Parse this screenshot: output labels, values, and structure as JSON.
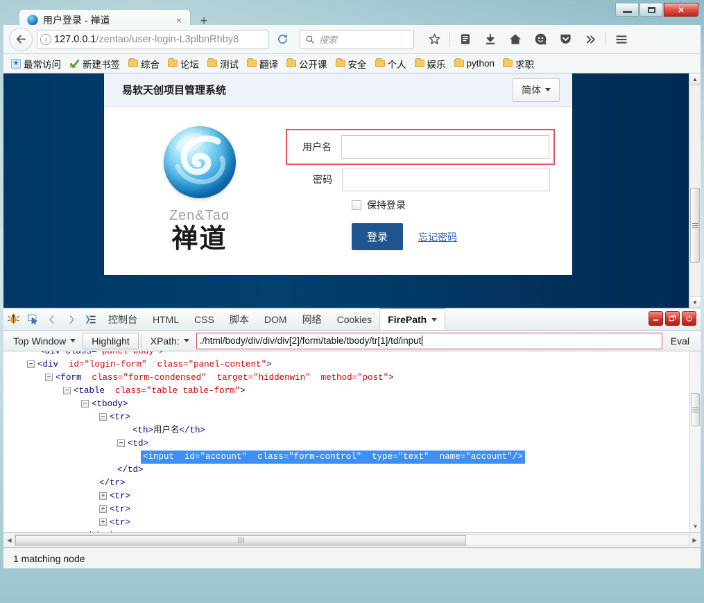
{
  "window": {
    "minimize_label": "Minimize",
    "maximize_label": "Maximize",
    "close_label": "×"
  },
  "browser": {
    "tab": {
      "title": "用户登录 - 禅道",
      "close_label": "×"
    },
    "new_tab_label": "+",
    "nav": {
      "back_label": "←",
      "url_host": "127.0.0.1",
      "url_path": "/zentao/user-login-L3plbnRhby8",
      "reload_label": "⟳",
      "search_placeholder": "搜索"
    },
    "bookmarks": [
      {
        "label": "最常访问",
        "icon": "most-visited-icon"
      },
      {
        "label": "新建书签",
        "icon": "check-icon"
      },
      {
        "label": "综合",
        "icon": "folder-icon"
      },
      {
        "label": "论坛",
        "icon": "folder-icon"
      },
      {
        "label": "测试",
        "icon": "folder-icon"
      },
      {
        "label": "翻译",
        "icon": "folder-icon"
      },
      {
        "label": "公开课",
        "icon": "folder-icon"
      },
      {
        "label": "安全",
        "icon": "folder-icon"
      },
      {
        "label": "个人",
        "icon": "folder-icon"
      },
      {
        "label": "娱乐",
        "icon": "folder-icon"
      },
      {
        "label": "python",
        "icon": "folder-icon"
      },
      {
        "label": "求职",
        "icon": "folder-icon"
      }
    ]
  },
  "page": {
    "panel_title": "易软天创项目管理系统",
    "language_button": "简体",
    "logo": {
      "text_en": "Zen&Tao",
      "text_cn": "禅道"
    },
    "form": {
      "account_label": "用户名",
      "account_value": "",
      "password_label": "密码",
      "password_value": "",
      "keep_login_label": "保持登录",
      "keep_login_checked": false,
      "login_button": "登录",
      "forgot_link": "忘记密码"
    }
  },
  "firebug": {
    "tabs": [
      {
        "label": "控制台",
        "active": false
      },
      {
        "label": "HTML",
        "active": false
      },
      {
        "label": "CSS",
        "active": false
      },
      {
        "label": "脚本",
        "active": false
      },
      {
        "label": "DOM",
        "active": false
      },
      {
        "label": "网络",
        "active": false
      },
      {
        "label": "Cookies",
        "active": false
      },
      {
        "label": "FirePath",
        "active": true
      }
    ],
    "window_buttons": [
      "minimize",
      "detach",
      "close"
    ],
    "xpath_bar": {
      "context_label": "Top Window",
      "highlight_label": "Highlight",
      "mode_label": "XPath:",
      "expression": "./html/body/div/div/div[2]/form/table/tbody/tr[1]/td/input",
      "eval_label": "Eval"
    },
    "tree": [
      {
        "indent": 0,
        "toggle": "none",
        "content": "partial",
        "text": "div  class=\"panel-body\""
      },
      {
        "indent": 0,
        "toggle": "minus",
        "tag": "div",
        "attrs": [
          [
            "id",
            "login-form"
          ],
          [
            "class",
            "panel-content"
          ]
        ]
      },
      {
        "indent": 1,
        "toggle": "minus",
        "tag": "form",
        "attrs": [
          [
            "class",
            "form-condensed"
          ],
          [
            "target",
            "hiddenwin"
          ],
          [
            "method",
            "post"
          ]
        ]
      },
      {
        "indent": 2,
        "toggle": "minus",
        "tag": "table",
        "attrs": [
          [
            "class",
            "table table-form"
          ]
        ]
      },
      {
        "indent": 3,
        "toggle": "minus",
        "tag": "tbody",
        "attrs": []
      },
      {
        "indent": 4,
        "toggle": "minus",
        "tag": "tr",
        "attrs": []
      },
      {
        "indent": 5,
        "toggle": "none",
        "tag": "th",
        "attrs": [],
        "text": "用户名",
        "closing": "</th>"
      },
      {
        "indent": 5,
        "toggle": "minus",
        "tag": "td",
        "attrs": []
      },
      {
        "indent": 6,
        "toggle": "none",
        "tag": "input",
        "attrs": [
          [
            "id",
            "account"
          ],
          [
            "class",
            "form-control"
          ],
          [
            "type",
            "text"
          ],
          [
            "name",
            "account"
          ]
        ],
        "selected": true
      },
      {
        "indent": 5,
        "toggle": "none",
        "closing": "</td>"
      },
      {
        "indent": 4,
        "toggle": "none",
        "closing": "</tr>"
      },
      {
        "indent": 4,
        "toggle": "plus",
        "tag": "tr",
        "attrs": []
      },
      {
        "indent": 4,
        "toggle": "plus",
        "tag": "tr",
        "attrs": []
      },
      {
        "indent": 4,
        "toggle": "plus",
        "tag": "tr",
        "attrs": []
      },
      {
        "indent": 3,
        "toggle": "none",
        "closing": "</tbody>"
      }
    ],
    "status": "1 matching node"
  },
  "colors": {
    "page_background": "#013765",
    "accent_blue": "#20558f",
    "highlight_red": "#e8515a",
    "selection_blue": "#3d8ef5",
    "titlebar": "#b9d6dc"
  }
}
